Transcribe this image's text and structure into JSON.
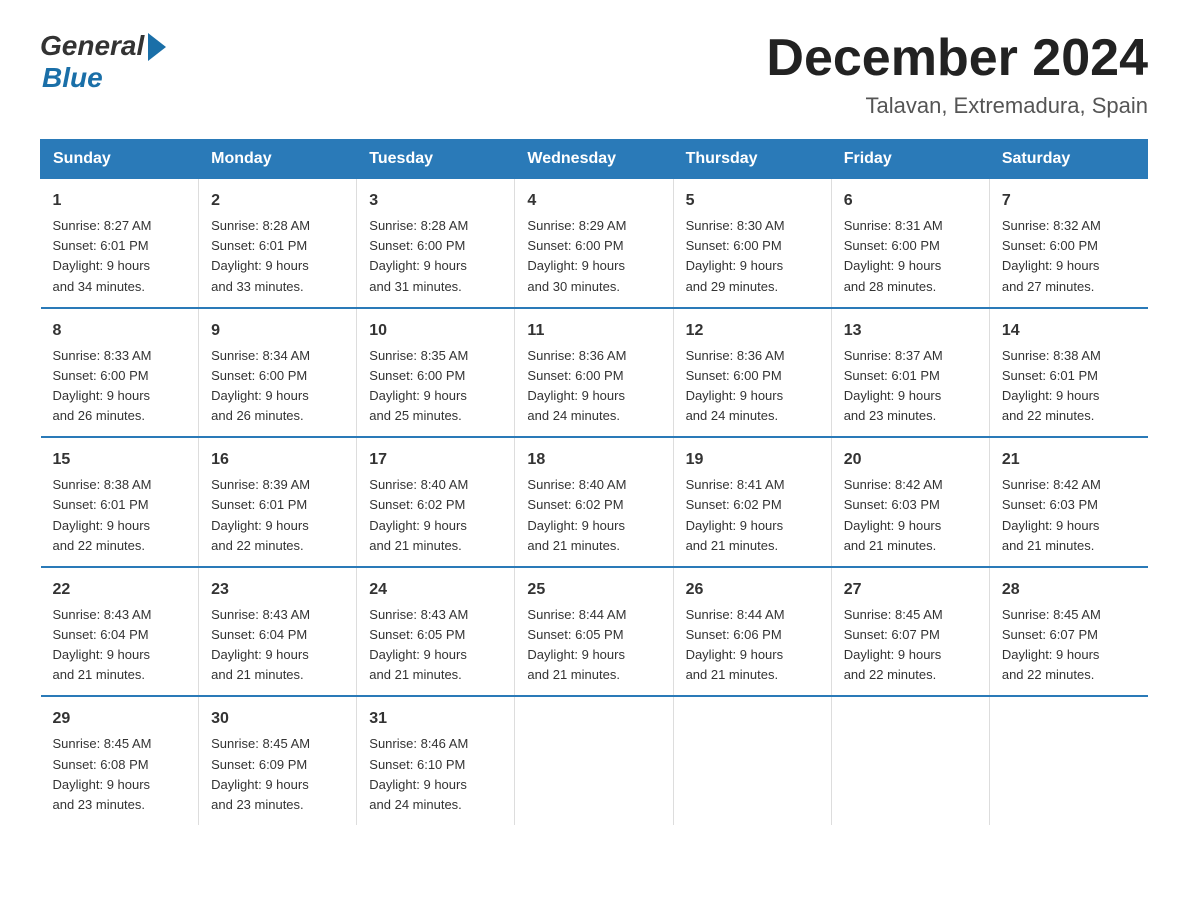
{
  "header": {
    "logo_general": "General",
    "logo_blue": "Blue",
    "main_title": "December 2024",
    "subtitle": "Talavan, Extremadura, Spain"
  },
  "days_of_week": [
    "Sunday",
    "Monday",
    "Tuesday",
    "Wednesday",
    "Thursday",
    "Friday",
    "Saturday"
  ],
  "weeks": [
    [
      {
        "date": "1",
        "sunrise": "8:27 AM",
        "sunset": "6:01 PM",
        "daylight": "9 hours and 34 minutes."
      },
      {
        "date": "2",
        "sunrise": "8:28 AM",
        "sunset": "6:01 PM",
        "daylight": "9 hours and 33 minutes."
      },
      {
        "date": "3",
        "sunrise": "8:28 AM",
        "sunset": "6:00 PM",
        "daylight": "9 hours and 31 minutes."
      },
      {
        "date": "4",
        "sunrise": "8:29 AM",
        "sunset": "6:00 PM",
        "daylight": "9 hours and 30 minutes."
      },
      {
        "date": "5",
        "sunrise": "8:30 AM",
        "sunset": "6:00 PM",
        "daylight": "9 hours and 29 minutes."
      },
      {
        "date": "6",
        "sunrise": "8:31 AM",
        "sunset": "6:00 PM",
        "daylight": "9 hours and 28 minutes."
      },
      {
        "date": "7",
        "sunrise": "8:32 AM",
        "sunset": "6:00 PM",
        "daylight": "9 hours and 27 minutes."
      }
    ],
    [
      {
        "date": "8",
        "sunrise": "8:33 AM",
        "sunset": "6:00 PM",
        "daylight": "9 hours and 26 minutes."
      },
      {
        "date": "9",
        "sunrise": "8:34 AM",
        "sunset": "6:00 PM",
        "daylight": "9 hours and 26 minutes."
      },
      {
        "date": "10",
        "sunrise": "8:35 AM",
        "sunset": "6:00 PM",
        "daylight": "9 hours and 25 minutes."
      },
      {
        "date": "11",
        "sunrise": "8:36 AM",
        "sunset": "6:00 PM",
        "daylight": "9 hours and 24 minutes."
      },
      {
        "date": "12",
        "sunrise": "8:36 AM",
        "sunset": "6:00 PM",
        "daylight": "9 hours and 24 minutes."
      },
      {
        "date": "13",
        "sunrise": "8:37 AM",
        "sunset": "6:01 PM",
        "daylight": "9 hours and 23 minutes."
      },
      {
        "date": "14",
        "sunrise": "8:38 AM",
        "sunset": "6:01 PM",
        "daylight": "9 hours and 22 minutes."
      }
    ],
    [
      {
        "date": "15",
        "sunrise": "8:38 AM",
        "sunset": "6:01 PM",
        "daylight": "9 hours and 22 minutes."
      },
      {
        "date": "16",
        "sunrise": "8:39 AM",
        "sunset": "6:01 PM",
        "daylight": "9 hours and 22 minutes."
      },
      {
        "date": "17",
        "sunrise": "8:40 AM",
        "sunset": "6:02 PM",
        "daylight": "9 hours and 21 minutes."
      },
      {
        "date": "18",
        "sunrise": "8:40 AM",
        "sunset": "6:02 PM",
        "daylight": "9 hours and 21 minutes."
      },
      {
        "date": "19",
        "sunrise": "8:41 AM",
        "sunset": "6:02 PM",
        "daylight": "9 hours and 21 minutes."
      },
      {
        "date": "20",
        "sunrise": "8:42 AM",
        "sunset": "6:03 PM",
        "daylight": "9 hours and 21 minutes."
      },
      {
        "date": "21",
        "sunrise": "8:42 AM",
        "sunset": "6:03 PM",
        "daylight": "9 hours and 21 minutes."
      }
    ],
    [
      {
        "date": "22",
        "sunrise": "8:43 AM",
        "sunset": "6:04 PM",
        "daylight": "9 hours and 21 minutes."
      },
      {
        "date": "23",
        "sunrise": "8:43 AM",
        "sunset": "6:04 PM",
        "daylight": "9 hours and 21 minutes."
      },
      {
        "date": "24",
        "sunrise": "8:43 AM",
        "sunset": "6:05 PM",
        "daylight": "9 hours and 21 minutes."
      },
      {
        "date": "25",
        "sunrise": "8:44 AM",
        "sunset": "6:05 PM",
        "daylight": "9 hours and 21 minutes."
      },
      {
        "date": "26",
        "sunrise": "8:44 AM",
        "sunset": "6:06 PM",
        "daylight": "9 hours and 21 minutes."
      },
      {
        "date": "27",
        "sunrise": "8:45 AM",
        "sunset": "6:07 PM",
        "daylight": "9 hours and 22 minutes."
      },
      {
        "date": "28",
        "sunrise": "8:45 AM",
        "sunset": "6:07 PM",
        "daylight": "9 hours and 22 minutes."
      }
    ],
    [
      {
        "date": "29",
        "sunrise": "8:45 AM",
        "sunset": "6:08 PM",
        "daylight": "9 hours and 23 minutes."
      },
      {
        "date": "30",
        "sunrise": "8:45 AM",
        "sunset": "6:09 PM",
        "daylight": "9 hours and 23 minutes."
      },
      {
        "date": "31",
        "sunrise": "8:46 AM",
        "sunset": "6:10 PM",
        "daylight": "9 hours and 24 minutes."
      },
      null,
      null,
      null,
      null
    ]
  ],
  "labels": {
    "sunrise": "Sunrise:",
    "sunset": "Sunset:",
    "daylight": "Daylight:"
  }
}
